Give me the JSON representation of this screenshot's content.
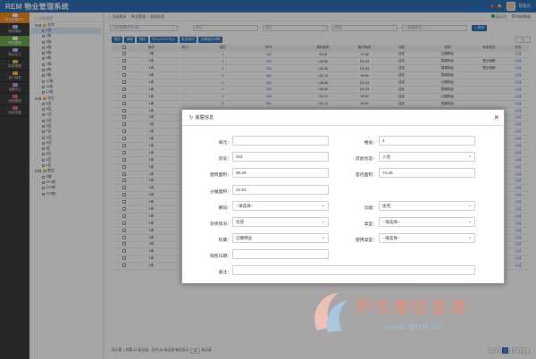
{
  "app": {
    "title": "REM 物业管理系统",
    "user": "管理员",
    "user_role": "管理员",
    "badge_count": "8"
  },
  "nav": [
    {
      "label": "物业数据中心",
      "state": "active"
    },
    {
      "label": "物业基础",
      "state": "normal"
    },
    {
      "label": "物业管理",
      "state": "green"
    },
    {
      "label": "物业业主",
      "state": "normal"
    },
    {
      "label": "财务管理",
      "state": "normal"
    },
    {
      "label": "客户服务",
      "state": "normal"
    },
    {
      "label": "设置中心",
      "state": "normal"
    },
    {
      "label": "系统管理",
      "state": "normal"
    },
    {
      "label": "系统设置",
      "state": "normal"
    }
  ],
  "tree": {
    "search_placeholder": "已经选择",
    "nodes": [
      "住宅",
      "1栋",
      "2栋",
      "3栋",
      "4栋",
      "5栋",
      "6栋",
      "7栋",
      "8栋",
      "9栋",
      "10栋",
      "11栋",
      "12栋",
      "车位",
      "A区",
      "B区",
      "C区",
      "D区",
      "E区",
      "F区",
      "G区",
      "H区",
      "I区",
      "J区",
      "K区",
      "L区",
      "商业",
      "1铺",
      "1F1铺",
      "1F2铺",
      "1F3铺"
    ],
    "selected_index": 1
  },
  "breadcrumb": {
    "home": "当前模块",
    "path1": "物业管理",
    "path2": "房屋信息",
    "opt1": "显示列",
    "opt2": "刷新数据"
  },
  "filters": {
    "current_node": "已经选择住宅/1栋",
    "unit": "单元",
    "room": "房号",
    "floor": "楼层",
    "state": "—房屋状态—",
    "query_btn": "查询"
  },
  "toolbar": {
    "add": "增加",
    "edit": "编辑",
    "delete": "删除",
    "import": "导入EXCEL导入",
    "batch": "批量修改",
    "set": "设置楼层间隔"
  },
  "table": {
    "headers": [
      "楼栋",
      "单元",
      "楼层",
      "房号",
      "建筑面积",
      "套内面积",
      "功能",
      "权属",
      "使用类型",
      "状态"
    ],
    "rows": [
      [
        "1栋",
        "-",
        "1",
        "102",
        "99.29",
        "74.38",
        "住宅",
        "已缴物业",
        "",
        "入住"
      ],
      [
        "1栋",
        "-",
        "1",
        "103",
        "146.66",
        "111.53",
        "住宅",
        "拨离物业",
        "物业用房",
        "入住"
      ],
      [
        "1栋",
        "-",
        "1",
        "104",
        "146.66",
        "111.53",
        "住宅",
        "拨离物业",
        "物业用房",
        "入住"
      ],
      [
        "1栋",
        "-",
        "2",
        "201",
        "132.14",
        "99.99",
        "住宅",
        "拨离物业",
        "",
        "入住"
      ],
      [
        "1栋",
        "-",
        "2",
        "202",
        "146.66",
        "111.53",
        "住宅",
        "已缴物业",
        "",
        "入住"
      ],
      [
        "1栋",
        "-",
        "2",
        "203",
        "146.66",
        "111.53",
        "住宅",
        "拨离物业",
        "",
        "入住"
      ],
      [
        "1栋",
        "-",
        "2",
        "204",
        "132.41",
        "99.99",
        "住宅",
        "已缴物业",
        "",
        "入住"
      ],
      [
        "1栋",
        "-",
        "3",
        "301",
        "132.14",
        "99.99",
        "住宅",
        "拨离物业",
        "",
        "入住"
      ],
      [
        "1栋",
        "-",
        "3",
        "302",
        "146.66",
        "111.53",
        "住宅",
        "已缴物业",
        "",
        "入住"
      ],
      [
        "1栋",
        "-",
        "3",
        "303",
        "146.66",
        "111.53",
        "住宅",
        "拨离物业",
        "",
        "入住"
      ],
      [
        "1栋",
        "-",
        "3",
        "304",
        "132.41",
        "99.99",
        "住宅",
        "已缴物业",
        "",
        "入住"
      ],
      [
        "1栋",
        "-",
        "4",
        "401",
        "132.14",
        "99.99",
        "住宅",
        "拨离物业",
        "",
        "入住"
      ],
      [
        "1栋",
        "-",
        "4",
        "402",
        "99.29",
        "74.38",
        "住宅",
        "已缴物业",
        "",
        "入住"
      ],
      [
        "1栋",
        "-",
        "4",
        "403",
        "146.66",
        "111.53",
        "住宅",
        "拨离物业",
        "",
        "入住"
      ],
      [
        "1栋",
        "-",
        "5",
        "501",
        "132.14",
        "99.99",
        "住宅",
        "已缴物业",
        "",
        "入住"
      ],
      [
        "1栋",
        "-",
        "5",
        "502",
        "146.66",
        "111.53",
        "住宅",
        "拨离物业",
        "",
        "入住"
      ],
      [
        "1栋",
        "-",
        "5",
        "503",
        "146.66",
        "111.53",
        "住宅",
        "已缴物业",
        "",
        "入住"
      ],
      [
        "1栋",
        "-",
        "6",
        "601",
        "132.14",
        "99.99",
        "住宅",
        "拨离物业",
        "",
        "入住"
      ],
      [
        "1栋",
        "-",
        "6",
        "602",
        "146.66",
        "111.53",
        "住宅",
        "已缴物业",
        "",
        "入住"
      ],
      [
        "1栋",
        "-",
        "6",
        "603",
        "146.66",
        "111.53",
        "住宅",
        "拨离物业",
        "",
        "入住"
      ],
      [
        "1栋",
        "-",
        "6",
        "604",
        "132.41",
        "99.99",
        "住宅",
        "已缴物业",
        "",
        "入住"
      ],
      [
        "1栋",
        "-",
        "7",
        "701",
        "132.14",
        "99.99",
        "住宅",
        "拨离物业",
        "",
        "入住"
      ],
      [
        "1栋",
        "-",
        "7",
        "702",
        "146.66",
        "111.53",
        "住宅",
        "已缴物业",
        "",
        "入住"
      ],
      [
        "1栋",
        "-",
        "7",
        "703",
        "146.66",
        "111.53",
        "住宅",
        "拨离物业",
        "",
        "入住"
      ],
      [
        "1栋",
        "-",
        "7",
        "704",
        "132.41",
        "99.99",
        "住宅",
        "已缴物业",
        "",
        "入住"
      ],
      [
        "1栋",
        "-",
        "8",
        "801",
        "132.14",
        "99.99",
        "住宅",
        "拨离物业",
        "",
        "入住"
      ],
      [
        "1栋",
        "-",
        "8",
        "802",
        "146.66",
        "111.53",
        "住宅",
        "已缴物业",
        "",
        "入住"
      ],
      [
        "1栋",
        "-",
        "9",
        "901",
        "132.14",
        "99.99",
        "住宅",
        "拨离物业",
        "",
        "入住"
      ],
      [
        "1栋",
        "-",
        "9",
        "902",
        "146.66",
        "111.53",
        "住宅",
        "已缴物业",
        "",
        "入住"
      ],
      [
        "1栋",
        "-",
        "9",
        "903",
        "132.41",
        "99.99",
        "住宅",
        "拨离物业",
        "",
        "入住"
      ],
      [
        "1栋",
        "-",
        "9",
        "904",
        "146.66",
        "111.53",
        "住宅",
        "已缴物业",
        "",
        "入住"
      ]
    ]
  },
  "pager": {
    "summary": "显示第 1 到第 25 条记录，总共 85 条记录 每页显示",
    "page_size": "25",
    "summary_tail": "条记录",
    "pages": [
      "‹",
      "1",
      "2",
      "3",
      "4",
      "›"
    ],
    "current": "2"
  },
  "modal": {
    "title": "房屋信息",
    "close": "×",
    "fields": {
      "unit_label": "单元：",
      "unit_value": "",
      "floor_label": "楼层：",
      "floor_value": "4",
      "room_label": "房号：",
      "room_value": "402",
      "status_label": "房屋状态：",
      "status_value": "入住",
      "area_label": "建筑面积：",
      "area_value": "99.29",
      "inner_label": "套内面积：",
      "inner_value": "74.38",
      "share_label": "分摊面积：",
      "share_value": "24.91",
      "orient_label": "朝向：",
      "orient_value": "--请选择--",
      "func_label": "功能：",
      "func_value": "住宅",
      "deco_label": "装修情况：",
      "deco_value": "毛坯",
      "type_label": "类型：",
      "type_value": "--请选择--",
      "owner_label": "权属：",
      "owner_value": "已缴物业",
      "use_label": "使用类型：",
      "use_value": "--请选择--",
      "sale_label": "销售日期：",
      "sale_value": "",
      "remark_label": "备注：",
      "remark_value": ""
    }
  },
  "watermark": {
    "cn": "黔东南信息港",
    "en": "www.QDN.cn"
  },
  "colors": {
    "primary": "#2f6fb5",
    "nav_active": "#f08a24",
    "nav_green": "#6aa84f",
    "close": "#d22222"
  }
}
